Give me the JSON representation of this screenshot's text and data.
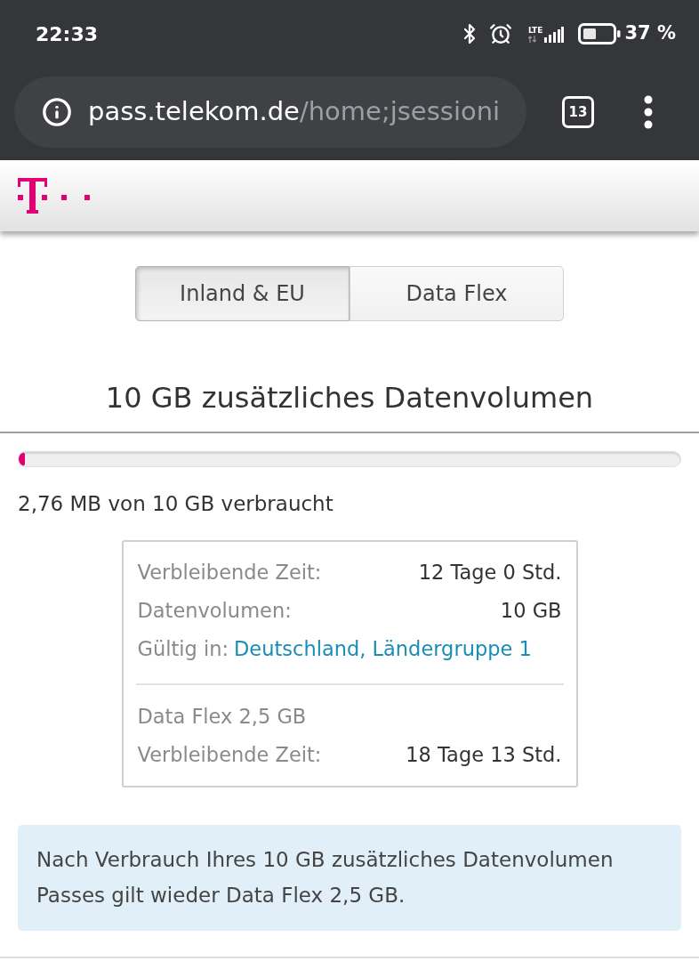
{
  "status_bar": {
    "time": "22:33",
    "network": "LTE",
    "battery": "37 %"
  },
  "browser": {
    "url_host": "pass.telekom.de",
    "url_path": "/home;jsessioni",
    "tab_count": "13"
  },
  "tabs": [
    {
      "label": "Inland & EU",
      "selected": true
    },
    {
      "label": "Data Flex",
      "selected": false
    }
  ],
  "heading": "10 GB zusätzliches Datenvolumen",
  "usage": {
    "level": 0.01,
    "text": "2,76 MB von 10 GB verbraucht"
  },
  "details": {
    "sections": [
      {
        "rows": [
          {
            "label": "Verbleibende Zeit:",
            "value": "12 Tage 0 Std.",
            "kind": "text"
          },
          {
            "label": "Datenvolumen:",
            "value": "10 GB",
            "kind": "text"
          },
          {
            "label": "Gültig in:",
            "value": "Deutschland, Ländergruppe 1",
            "kind": "link"
          }
        ]
      },
      {
        "title": "Data Flex 2,5 GB",
        "rows": [
          {
            "label": "Verbleibende Zeit:",
            "value": "18 Tage 13 Std.",
            "kind": "text"
          }
        ]
      }
    ]
  },
  "notice": "Nach Verbrauch Ihres 10 GB zusätzliches Datenvolumen Passes gilt wieder Data Flex 2,5 GB."
}
